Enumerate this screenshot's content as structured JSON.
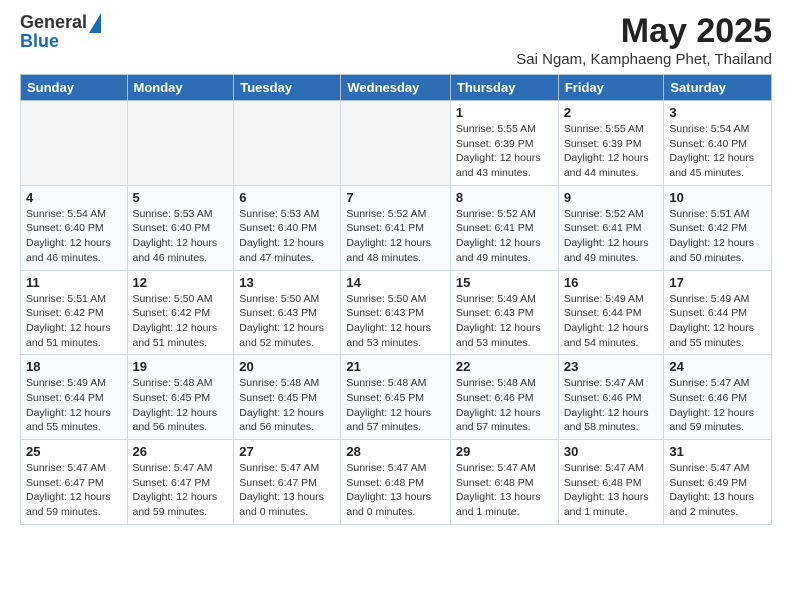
{
  "header": {
    "logo_general": "General",
    "logo_blue": "Blue",
    "main_title": "May 2025",
    "sub_title": "Sai Ngam, Kamphaeng Phet, Thailand"
  },
  "days_of_week": [
    "Sunday",
    "Monday",
    "Tuesday",
    "Wednesday",
    "Thursday",
    "Friday",
    "Saturday"
  ],
  "weeks": [
    [
      {
        "num": "",
        "detail": ""
      },
      {
        "num": "",
        "detail": ""
      },
      {
        "num": "",
        "detail": ""
      },
      {
        "num": "",
        "detail": ""
      },
      {
        "num": "1",
        "detail": "Sunrise: 5:55 AM\nSunset: 6:39 PM\nDaylight: 12 hours\nand 43 minutes."
      },
      {
        "num": "2",
        "detail": "Sunrise: 5:55 AM\nSunset: 6:39 PM\nDaylight: 12 hours\nand 44 minutes."
      },
      {
        "num": "3",
        "detail": "Sunrise: 5:54 AM\nSunset: 6:40 PM\nDaylight: 12 hours\nand 45 minutes."
      }
    ],
    [
      {
        "num": "4",
        "detail": "Sunrise: 5:54 AM\nSunset: 6:40 PM\nDaylight: 12 hours\nand 46 minutes."
      },
      {
        "num": "5",
        "detail": "Sunrise: 5:53 AM\nSunset: 6:40 PM\nDaylight: 12 hours\nand 46 minutes."
      },
      {
        "num": "6",
        "detail": "Sunrise: 5:53 AM\nSunset: 6:40 PM\nDaylight: 12 hours\nand 47 minutes."
      },
      {
        "num": "7",
        "detail": "Sunrise: 5:52 AM\nSunset: 6:41 PM\nDaylight: 12 hours\nand 48 minutes."
      },
      {
        "num": "8",
        "detail": "Sunrise: 5:52 AM\nSunset: 6:41 PM\nDaylight: 12 hours\nand 49 minutes."
      },
      {
        "num": "9",
        "detail": "Sunrise: 5:52 AM\nSunset: 6:41 PM\nDaylight: 12 hours\nand 49 minutes."
      },
      {
        "num": "10",
        "detail": "Sunrise: 5:51 AM\nSunset: 6:42 PM\nDaylight: 12 hours\nand 50 minutes."
      }
    ],
    [
      {
        "num": "11",
        "detail": "Sunrise: 5:51 AM\nSunset: 6:42 PM\nDaylight: 12 hours\nand 51 minutes."
      },
      {
        "num": "12",
        "detail": "Sunrise: 5:50 AM\nSunset: 6:42 PM\nDaylight: 12 hours\nand 51 minutes."
      },
      {
        "num": "13",
        "detail": "Sunrise: 5:50 AM\nSunset: 6:43 PM\nDaylight: 12 hours\nand 52 minutes."
      },
      {
        "num": "14",
        "detail": "Sunrise: 5:50 AM\nSunset: 6:43 PM\nDaylight: 12 hours\nand 53 minutes."
      },
      {
        "num": "15",
        "detail": "Sunrise: 5:49 AM\nSunset: 6:43 PM\nDaylight: 12 hours\nand 53 minutes."
      },
      {
        "num": "16",
        "detail": "Sunrise: 5:49 AM\nSunset: 6:44 PM\nDaylight: 12 hours\nand 54 minutes."
      },
      {
        "num": "17",
        "detail": "Sunrise: 5:49 AM\nSunset: 6:44 PM\nDaylight: 12 hours\nand 55 minutes."
      }
    ],
    [
      {
        "num": "18",
        "detail": "Sunrise: 5:49 AM\nSunset: 6:44 PM\nDaylight: 12 hours\nand 55 minutes."
      },
      {
        "num": "19",
        "detail": "Sunrise: 5:48 AM\nSunset: 6:45 PM\nDaylight: 12 hours\nand 56 minutes."
      },
      {
        "num": "20",
        "detail": "Sunrise: 5:48 AM\nSunset: 6:45 PM\nDaylight: 12 hours\nand 56 minutes."
      },
      {
        "num": "21",
        "detail": "Sunrise: 5:48 AM\nSunset: 6:45 PM\nDaylight: 12 hours\nand 57 minutes."
      },
      {
        "num": "22",
        "detail": "Sunrise: 5:48 AM\nSunset: 6:46 PM\nDaylight: 12 hours\nand 57 minutes."
      },
      {
        "num": "23",
        "detail": "Sunrise: 5:47 AM\nSunset: 6:46 PM\nDaylight: 12 hours\nand 58 minutes."
      },
      {
        "num": "24",
        "detail": "Sunrise: 5:47 AM\nSunset: 6:46 PM\nDaylight: 12 hours\nand 59 minutes."
      }
    ],
    [
      {
        "num": "25",
        "detail": "Sunrise: 5:47 AM\nSunset: 6:47 PM\nDaylight: 12 hours\nand 59 minutes."
      },
      {
        "num": "26",
        "detail": "Sunrise: 5:47 AM\nSunset: 6:47 PM\nDaylight: 12 hours\nand 59 minutes."
      },
      {
        "num": "27",
        "detail": "Sunrise: 5:47 AM\nSunset: 6:47 PM\nDaylight: 13 hours\nand 0 minutes."
      },
      {
        "num": "28",
        "detail": "Sunrise: 5:47 AM\nSunset: 6:48 PM\nDaylight: 13 hours\nand 0 minutes."
      },
      {
        "num": "29",
        "detail": "Sunrise: 5:47 AM\nSunset: 6:48 PM\nDaylight: 13 hours\nand 1 minute."
      },
      {
        "num": "30",
        "detail": "Sunrise: 5:47 AM\nSunset: 6:48 PM\nDaylight: 13 hours\nand 1 minute."
      },
      {
        "num": "31",
        "detail": "Sunrise: 5:47 AM\nSunset: 6:49 PM\nDaylight: 13 hours\nand 2 minutes."
      }
    ]
  ]
}
